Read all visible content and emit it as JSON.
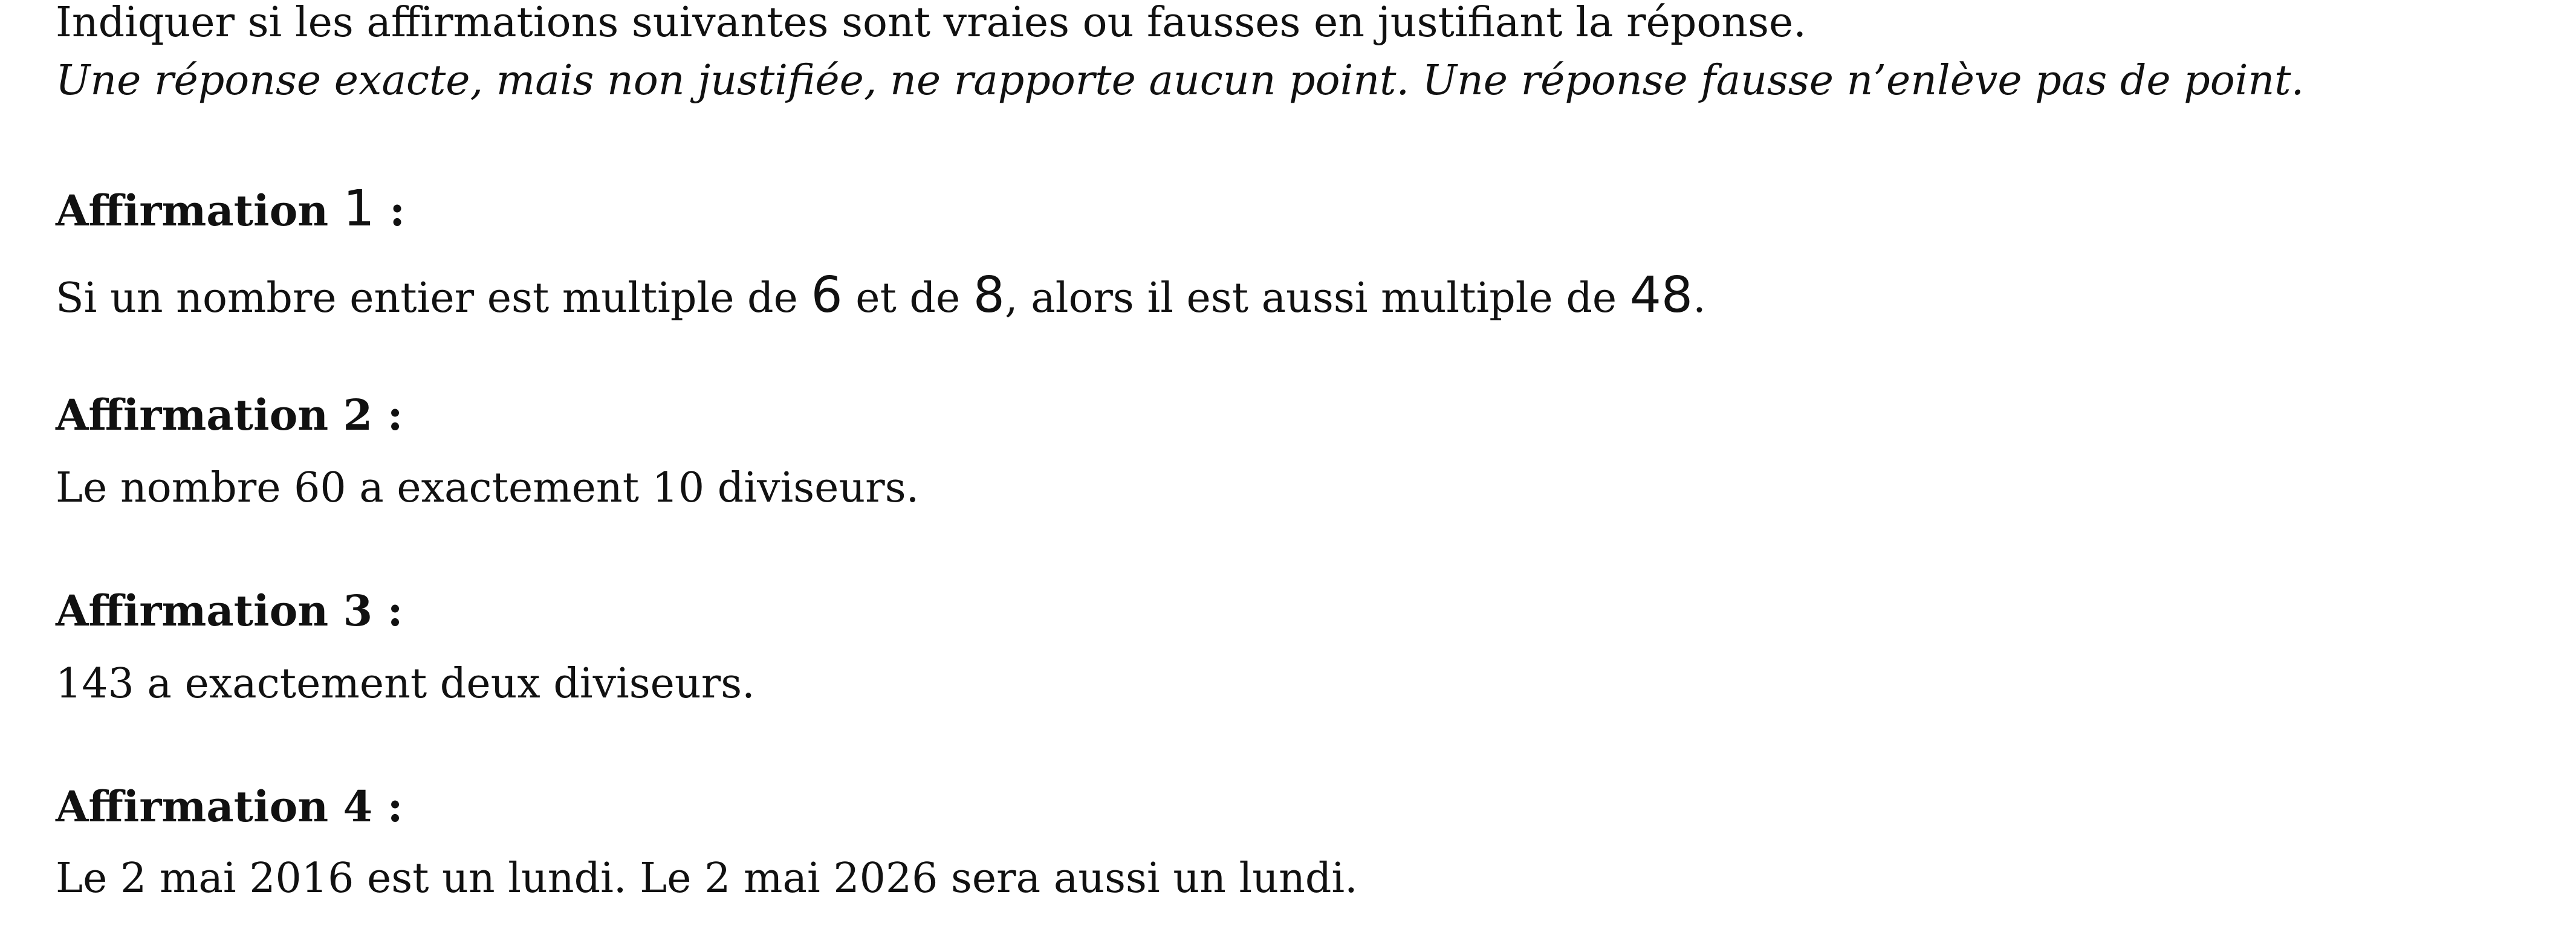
{
  "instructions": {
    "line1": "Indiquer si les affirmations suivantes sont vraies ou fausses en justifiant la réponse.",
    "line2": "Une réponse exacte, mais non justifiée, ne rapporte aucun point. Une réponse fausse n’enlève pas de point."
  },
  "affirmations": [
    {
      "label": "Affirmation ",
      "number": "1",
      "colon": " :",
      "statement": {
        "part1": "Si un nombre entier est multiple de ",
        "n1": "6",
        "part2": " et de ",
        "n2": "8",
        "part3": ", alors il est aussi multiple de ",
        "n3": "48",
        "part4": "."
      }
    },
    {
      "label": "Affirmation 2 :",
      "statement": "Le nombre 60 a exactement 10 diviseurs."
    },
    {
      "label": "Affirmation 3 :",
      "statement": "143 a exactement deux diviseurs."
    },
    {
      "label": "Affirmation 4 :",
      "statement": "Le 2 mai 2016 est un lundi. Le 2 mai 2026 sera aussi un lundi."
    }
  ]
}
